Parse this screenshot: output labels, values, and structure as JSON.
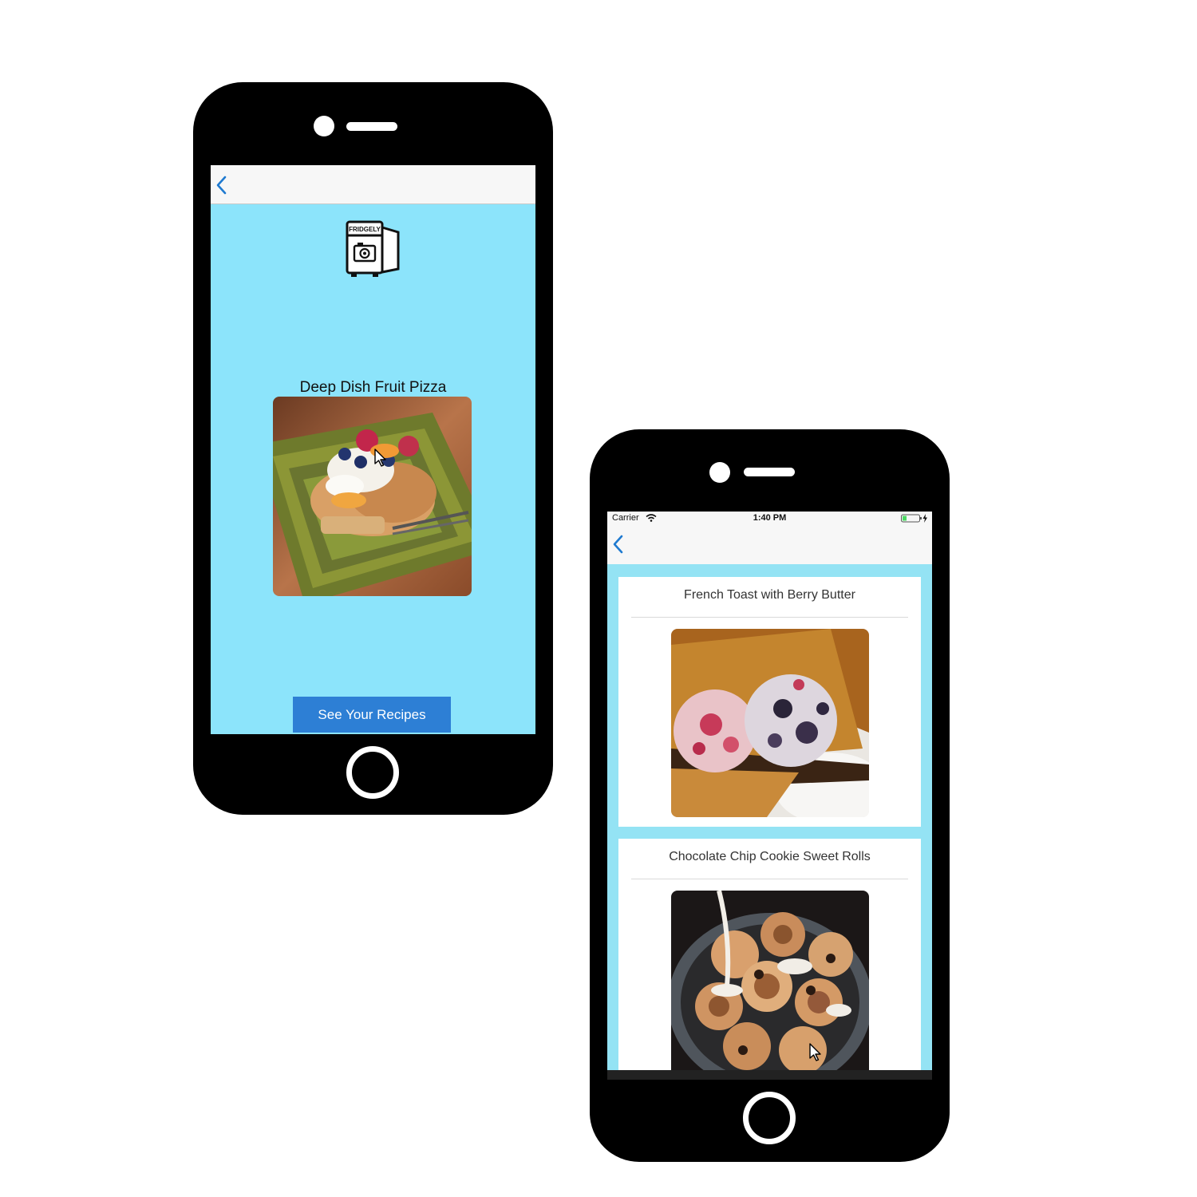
{
  "left_phone": {
    "screen_title": "Deep Dish Fruit Pizza",
    "logo_text": "FRIDGELY",
    "button_label": "See Your Recipes",
    "background_color": "#8ce4fb"
  },
  "right_phone": {
    "status_bar": {
      "carrier": "Carrier",
      "time": "1:40 PM"
    },
    "recipes": [
      {
        "title": "French Toast with Berry Butter",
        "image": "french-toast-photo"
      },
      {
        "title": "Chocolate Chip Cookie Sweet Rolls",
        "image": "sweet-rolls-photo"
      }
    ],
    "background_color": "#94e3f4"
  },
  "colors": {
    "accent": "#2d7fd5",
    "back_arrow": "#1f7ad0"
  }
}
